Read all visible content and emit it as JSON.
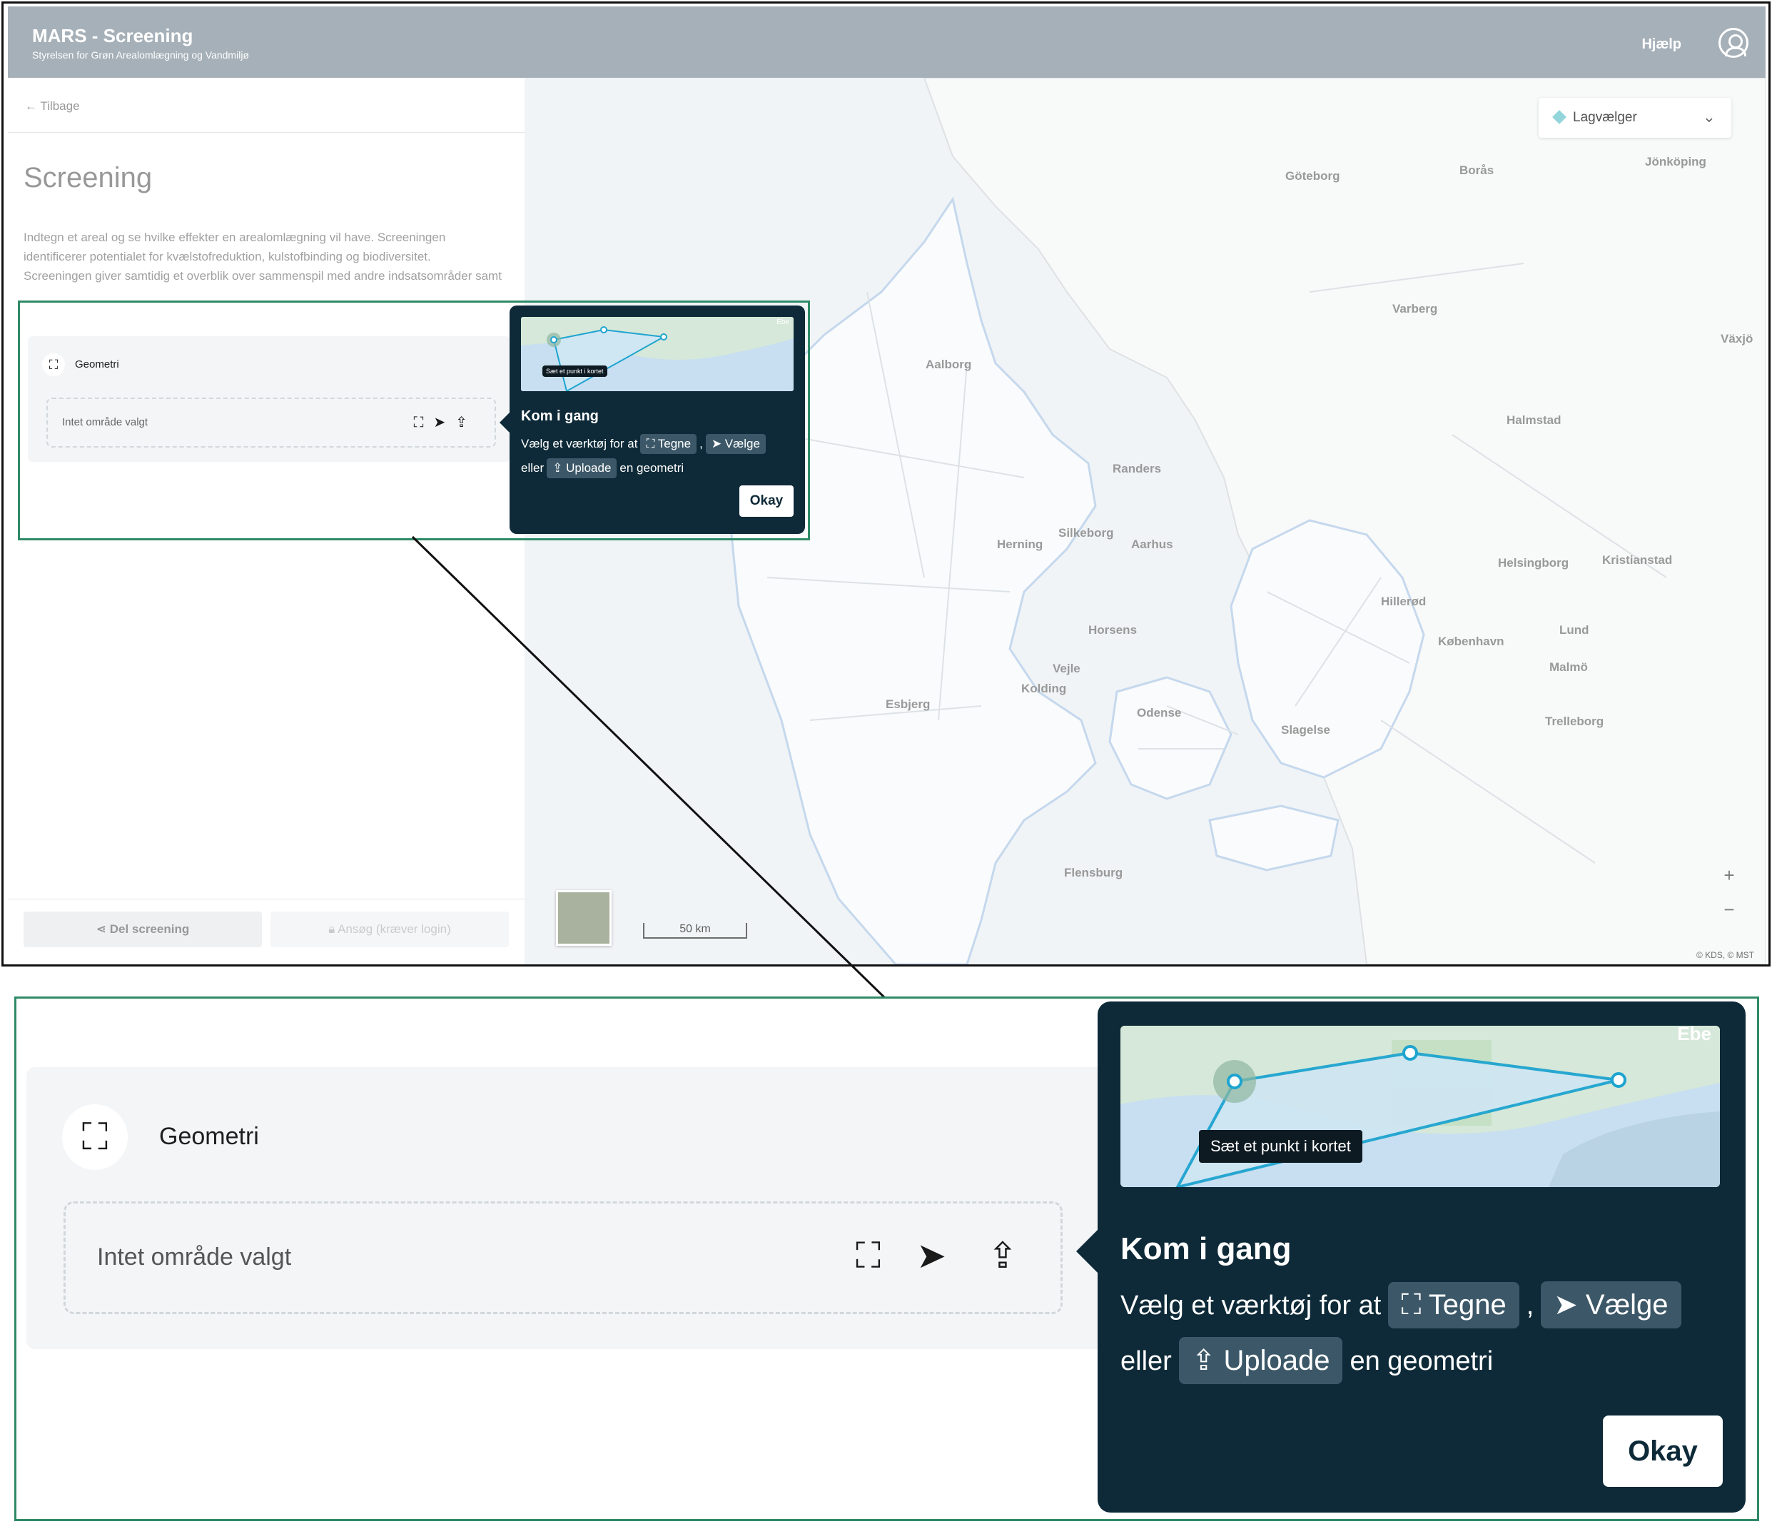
{
  "header": {
    "title": "MARS - Screening",
    "subtitle": "Styrelsen for Grøn Arealomlægning og Vandmiljø",
    "help_label": "Hjælp"
  },
  "side_panel": {
    "back_label": "Tilbage",
    "title": "Screening",
    "intro": "Indtegn et areal og se hvilke effekter en arealomlægning vil have. Screeningen identificerer potentialet for kvælstofreduktion, kulstofbinding og biodiversitet. Screeningen giver samtidig et overblik over sammenspil med andre indsatsområder samt mulige konflikter.",
    "share_label": "Del screening",
    "apply_label": "Ansøg (kræver login)"
  },
  "geometry": {
    "title": "Geometri",
    "placeholder": "Intet område valgt",
    "icon": "polygon-draw-icon",
    "tool_icons": [
      "polygon-draw-icon",
      "cursor-select-icon",
      "upload-icon"
    ]
  },
  "tooltip": {
    "title": "Kom i gang",
    "line1_prefix": "Vælg et værktøj for at",
    "chip_draw": "Tegne",
    "separator": ",",
    "chip_select": "Vælge",
    "line2_prefix": "eller",
    "chip_upload": "Uploade",
    "line2_suffix": "en geometri",
    "okay_label": "Okay",
    "preview_label": "Sæt et punkt i kortet",
    "preview_corner_text": "Ebe"
  },
  "map": {
    "layer_picker_label": "Lagvælger",
    "scale_label": "50 km",
    "attribution": "© KDS, © MST",
    "zoom_in": "+",
    "zoom_out": "−",
    "cities": [
      "Göteborg",
      "Borås",
      "Jönköping",
      "Aalborg",
      "Halmstad",
      "Helsingborg",
      "Kristianstad",
      "København",
      "Malmö",
      "Lund",
      "Trelleborg",
      "Flensburg",
      "Herning",
      "Aarhus",
      "Odense",
      "Vejle",
      "Kolding",
      "Esbjerg",
      "Randers",
      "Silkeborg",
      "Horsens",
      "Slagelse",
      "Hillerød",
      "Varberg",
      "Växjö"
    ]
  },
  "colors": {
    "header_bg": "#a6b0b8",
    "tooltip_bg": "#0e2a38",
    "chip_bg": "#3c5868",
    "highlight_border": "#2f8a67",
    "polygon_stroke": "#1ea4d0"
  }
}
